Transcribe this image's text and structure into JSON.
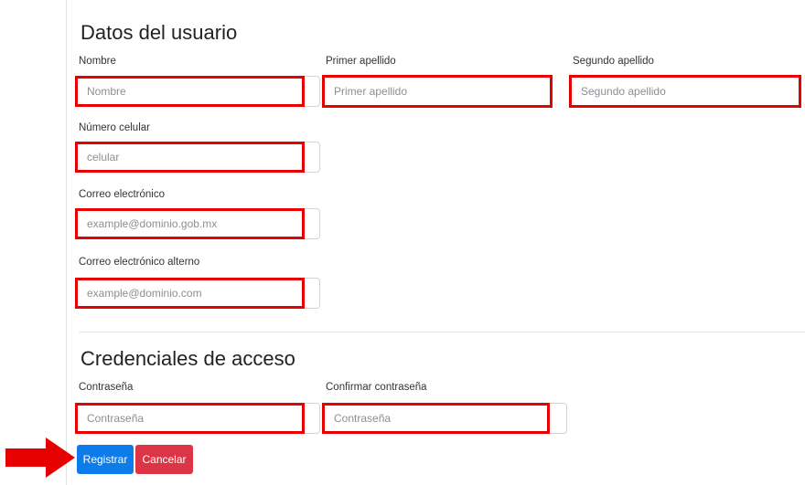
{
  "user_section": {
    "title": "Datos del usuario",
    "nombre": {
      "label": "Nombre",
      "placeholder": "Nombre"
    },
    "primer_apellido": {
      "label": "Primer apellido",
      "placeholder": "Primer apellido"
    },
    "segundo_apellido": {
      "label": "Segundo apellido",
      "placeholder": "Segundo apellido"
    },
    "celular": {
      "label": "Número celular",
      "placeholder": "celular"
    },
    "correo": {
      "label": "Correo electrónico",
      "placeholder": "example@dominio.gob.mx"
    },
    "correo_alterno": {
      "label": "Correo electrónico alterno",
      "placeholder": "example@dominio.com"
    }
  },
  "credentials_section": {
    "title": "Credenciales de acceso",
    "password": {
      "label": "Contraseña",
      "placeholder": "Contraseña"
    },
    "confirm_password": {
      "label": "Confirmar contraseña",
      "placeholder": "Contraseña"
    }
  },
  "actions": {
    "register_label": "Registrar",
    "cancel_label": "Cancelar"
  },
  "annotation": {
    "highlight_color": "#e60000",
    "arrow_icon": "right-arrow-icon"
  }
}
